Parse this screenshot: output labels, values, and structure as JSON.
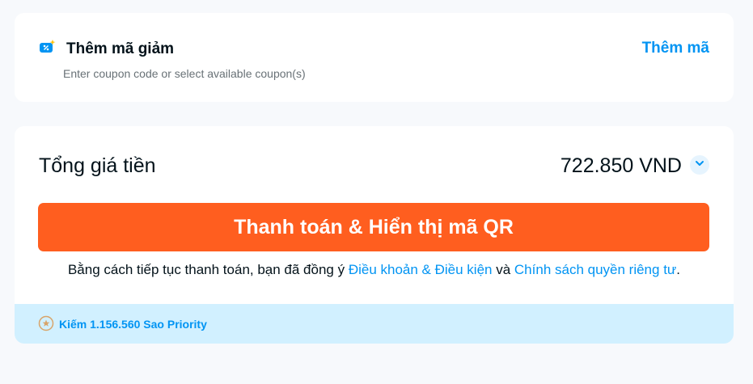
{
  "coupon": {
    "icon": "coupon-ticket-icon",
    "title": "Thêm mã giảm",
    "subtitle": "Enter coupon code or select available coupon(s)",
    "add_link": "Thêm mã"
  },
  "total": {
    "label": "Tổng giá tiền",
    "value": "722.850 VND",
    "toggle_icon": "chevron-down-icon"
  },
  "payment": {
    "button_label": "Thanh toán & Hiển thị mã QR"
  },
  "terms": {
    "prefix": "Bằng cách tiếp tục thanh toán, bạn đã đồng ý ",
    "terms_link": "Điều khoản & Điều kiện",
    "conjunction": " và ",
    "privacy_link": "Chính sách quyền riêng tư",
    "suffix": "."
  },
  "priority": {
    "icon": "star-coin-icon",
    "text": "Kiếm 1.156.560 Sao Priority"
  },
  "colors": {
    "accent_blue": "#0194f3",
    "pay_orange": "#ff5e1f",
    "priority_bg": "#d1f0ff"
  }
}
